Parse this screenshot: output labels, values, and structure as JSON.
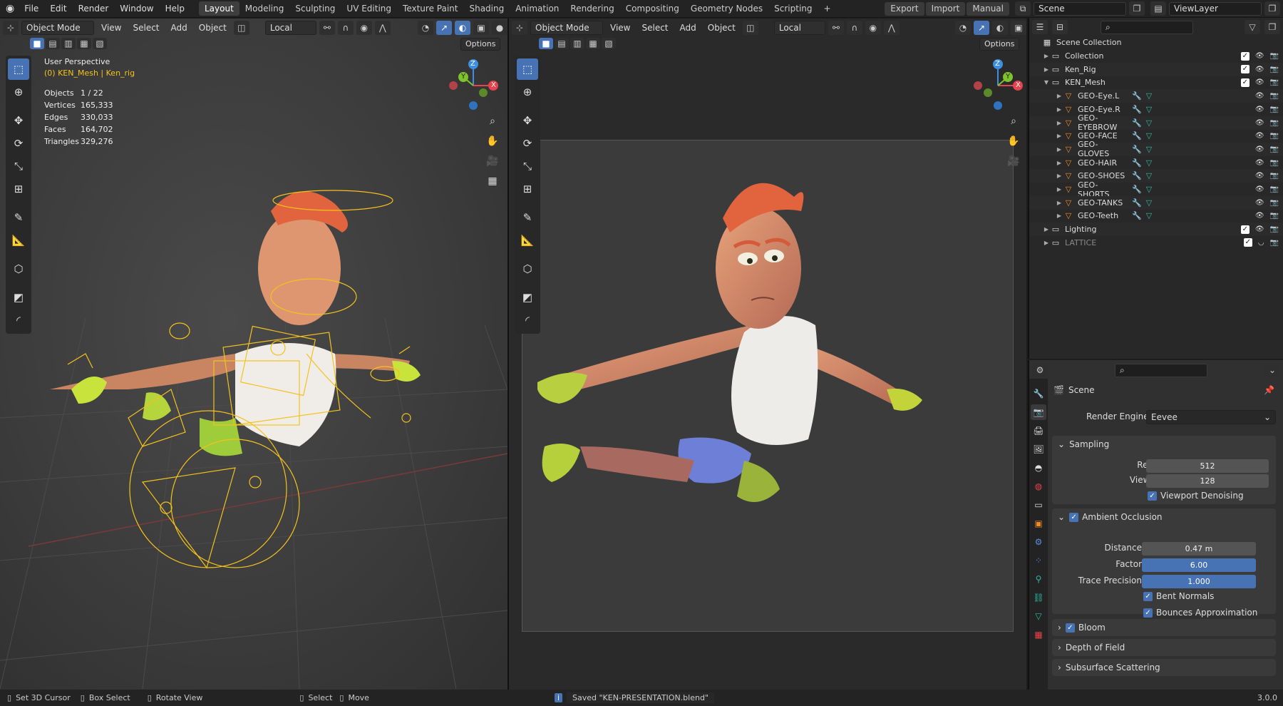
{
  "topbar": {
    "menus": [
      "File",
      "Edit",
      "Render",
      "Window",
      "Help"
    ],
    "workspaces": [
      "Layout",
      "Modeling",
      "Sculpting",
      "UV Editing",
      "Texture Paint",
      "Shading",
      "Animation",
      "Rendering",
      "Compositing",
      "Geometry Nodes",
      "Scripting"
    ],
    "active_workspace": "Layout",
    "add_tab": "+",
    "export_label": "Export",
    "import_label": "Import",
    "manual_label": "Manual",
    "scene_name": "Scene",
    "viewlayer_name": "ViewLayer"
  },
  "left_viewport": {
    "mode": "Object Mode",
    "menus": [
      "View",
      "Select",
      "Add",
      "Object"
    ],
    "orientation": "Local",
    "options_label": "Options",
    "view_name": "User Perspective",
    "active_object": "(0) KEN_Mesh | Ken_rig",
    "stats": [
      {
        "label": "Objects",
        "value": "1 / 22"
      },
      {
        "label": "Vertices",
        "value": "165,333"
      },
      {
        "label": "Edges",
        "value": "330,033"
      },
      {
        "label": "Faces",
        "value": "164,702"
      },
      {
        "label": "Triangles",
        "value": "329,276"
      }
    ],
    "gizmo": {
      "x": "X",
      "y": "Y",
      "z": "Z"
    }
  },
  "right_viewport": {
    "mode": "Object Mode",
    "menus": [
      "View",
      "Select",
      "Add",
      "Object"
    ],
    "orientation": "Local",
    "options_label": "Options",
    "gizmo": {
      "x": "X",
      "y": "Y",
      "z": "Z"
    }
  },
  "outliner": {
    "root": "Scene Collection",
    "rows": [
      {
        "name": "Collection",
        "indent": 1,
        "type": "collection",
        "expanded": false
      },
      {
        "name": "Ken_Rig",
        "indent": 1,
        "type": "collection",
        "expanded": false
      },
      {
        "name": "KEN_Mesh",
        "indent": 1,
        "type": "collection",
        "expanded": true
      },
      {
        "name": "GEO-Eye.L",
        "indent": 2,
        "type": "mesh"
      },
      {
        "name": "GEO-Eye.R",
        "indent": 2,
        "type": "mesh"
      },
      {
        "name": "GEO-EYEBROW",
        "indent": 2,
        "type": "mesh"
      },
      {
        "name": "GEO-FACE",
        "indent": 2,
        "type": "mesh"
      },
      {
        "name": "GEO-GLOVES",
        "indent": 2,
        "type": "mesh"
      },
      {
        "name": "GEO-HAIR",
        "indent": 2,
        "type": "mesh"
      },
      {
        "name": "GEO-SHOES",
        "indent": 2,
        "type": "mesh"
      },
      {
        "name": "GEO-SHORTS",
        "indent": 2,
        "type": "mesh"
      },
      {
        "name": "GEO-TANKS",
        "indent": 2,
        "type": "mesh"
      },
      {
        "name": "GEO-Teeth",
        "indent": 2,
        "type": "mesh"
      },
      {
        "name": "Lighting",
        "indent": 1,
        "type": "collection",
        "expanded": false
      },
      {
        "name": "LATTICE",
        "indent": 1,
        "type": "collection",
        "expanded": false,
        "dimmed": true
      }
    ]
  },
  "properties": {
    "context": "Scene",
    "render_engine_label": "Render Engine",
    "render_engine": "Eevee",
    "sampling": {
      "title": "Sampling",
      "render_label": "Render",
      "render": "512",
      "viewport_label": "Viewport",
      "viewport": "128",
      "denoise_label": "Viewport Denoising"
    },
    "ao": {
      "title": "Ambient Occlusion",
      "distance_label": "Distance",
      "distance": "0.47 m",
      "factor_label": "Factor",
      "factor": "6.00",
      "trace_label": "Trace Precision",
      "trace": "1.000",
      "bent_label": "Bent Normals",
      "bounces_label": "Bounces Approximation"
    },
    "bloom": "Bloom",
    "dof": "Depth of Field",
    "sss": "Subsurface Scattering"
  },
  "status": {
    "cursor": "Set 3D Cursor",
    "box": "Box Select",
    "rotate": "Rotate View",
    "select": "Select",
    "move": "Move",
    "message": "Saved \"KEN-PRESENTATION.blend\"",
    "version": "3.0.0"
  },
  "colors": {
    "accent": "#4772b3",
    "rig": "#f3c21c",
    "gizmo_x": "#e5434d",
    "gizmo_y": "#7ec32c",
    "gizmo_z": "#3b8fe5"
  }
}
